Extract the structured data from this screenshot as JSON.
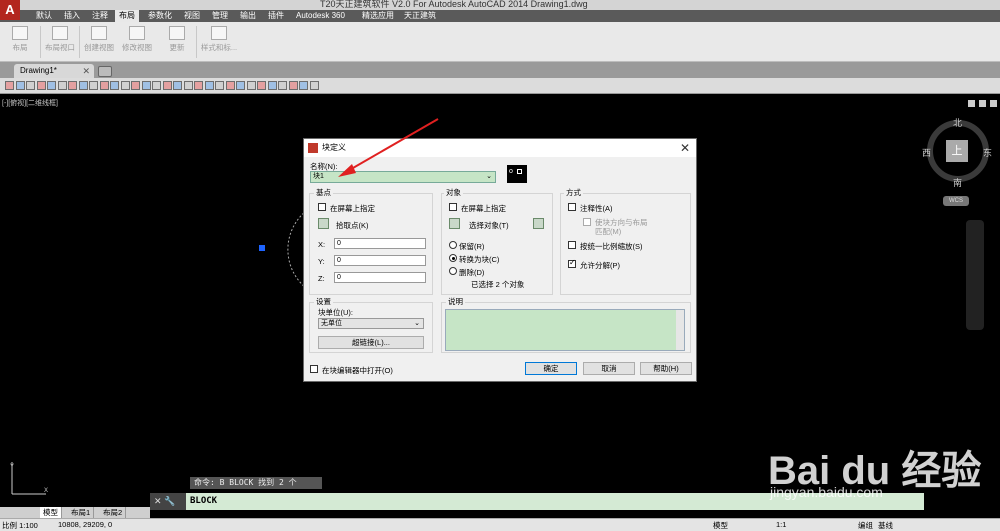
{
  "window": {
    "title": "T20天正建筑软件 V2.0 For Autodesk AutoCAD 2014    Drawing1.dwg"
  },
  "app_logo": "A",
  "ribbon": {
    "tabs": [
      "默认",
      "插入",
      "注释",
      "布局",
      "参数化",
      "视图",
      "管理",
      "输出",
      "插件",
      "Autodesk 360",
      "精选应用",
      "天正建筑"
    ],
    "active_tab": "布局",
    "buttons": [
      "布局",
      "布局视口",
      "创建视图",
      "修改视图",
      "更新",
      "样式和标..."
    ]
  },
  "doc_tabs": {
    "active": "Drawing1*",
    "close": "✕"
  },
  "viewport": {
    "label": "[-][俯视][二维线框]"
  },
  "compass": {
    "north": "北",
    "south": "南",
    "east": "东",
    "west": "西",
    "center": "上",
    "wcs": "WCS"
  },
  "dialog": {
    "title": "块定义",
    "close": "✕",
    "name_label": "名称(N):",
    "name_value": "块1",
    "basepoint": {
      "title": "基点",
      "onscreen": "在屏幕上指定",
      "pick": "拾取点(K)",
      "x_label": "X:",
      "x_value": "0",
      "y_label": "Y:",
      "y_value": "0",
      "z_label": "Z:",
      "z_value": "0"
    },
    "objects": {
      "title": "对象",
      "onscreen": "在屏幕上指定",
      "select": "选择对象(T)",
      "retain": "保留(R)",
      "convert": "转换为块(C)",
      "delete": "删除(D)",
      "selected": "已选择 2 个对象"
    },
    "behavior": {
      "title": "方式",
      "annotative": "注释性(A)",
      "match_orientation_1": "使块方向与布局",
      "match_orientation_2": "匹配(M)",
      "scale_uniformly": "按统一比例缩放(S)",
      "allow_explode": "允许分解(P)"
    },
    "settings": {
      "title": "设置",
      "unit_label": "块单位(U):",
      "unit_value": "无单位",
      "hyperlink": "超链接(L)..."
    },
    "description": {
      "title": "说明"
    },
    "open_in_editor": "在块编辑器中打开(O)",
    "ok": "确定",
    "cancel": "取消",
    "help": "帮助(H)"
  },
  "command": {
    "history": "命令: B BLOCK 找到 2 个",
    "prompt": "BLOCK",
    "side_icons": "✕ 🔧"
  },
  "layout_tabs": [
    "模型",
    "布局1",
    "布局2"
  ],
  "statusbar": {
    "scale": "比例 1:100",
    "coords": "10808, 29209, 0",
    "right_labels": [
      "模型",
      "编组",
      "基线"
    ],
    "annotation_scale": "1:1"
  },
  "watermark": {
    "brand": "Bai du 经验",
    "url": "jingyan.baidu.com"
  },
  "colors": {
    "accent": "#0078d7",
    "cmd_bg": "#d4ead4",
    "input_green": "#c6e5c6",
    "arrow": "#e02020"
  }
}
